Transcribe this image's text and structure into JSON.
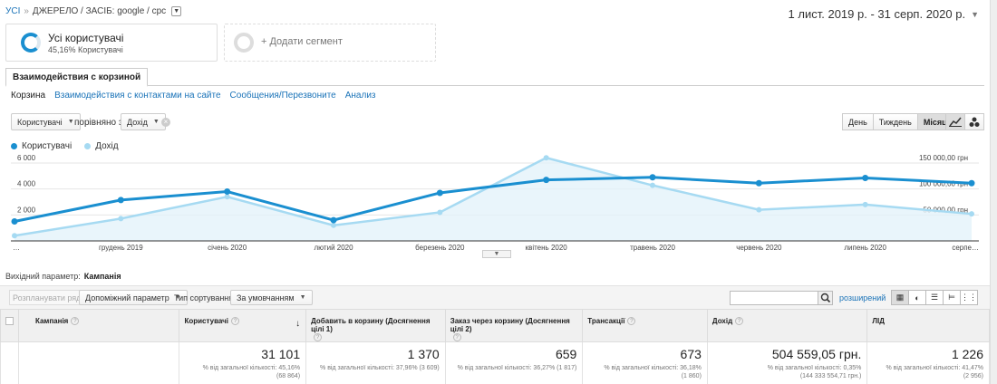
{
  "breadcrumb": {
    "all": "УСІ",
    "sep": "»",
    "source": "ДЖЕРЕЛО / ЗАСІБ: google / cpc"
  },
  "date_range": "1 лист. 2019 р. - 31 серп. 2020 р.",
  "segments": [
    {
      "title": "Усі користувачі",
      "subtitle": "45,16% Користувачі"
    },
    {
      "title": "+ Додати сегмент"
    }
  ],
  "tab": "Взаимодействия с корзиной",
  "subnav": [
    "Корзина",
    "Взаимодействия с контактами на сайте",
    "Сообщения/Перезвоните",
    "Анализ"
  ],
  "controls": {
    "metric1": "Користувачі",
    "compare_label": "порівняно з",
    "metric2": "Дохід",
    "periods": [
      "День",
      "Тиждень",
      "Місяць"
    ],
    "active_period": "Місяць"
  },
  "chart_data": {
    "type": "line",
    "x": [
      "…",
      "грудень 2019",
      "січень 2020",
      "лютий 2020",
      "березень 2020",
      "квітень 2020",
      "травень 2020",
      "червень 2020",
      "липень 2020",
      "серпе…"
    ],
    "series": [
      {
        "name": "Користувачі",
        "axis": "left",
        "color": "#1a8fd0",
        "values": [
          1500,
          3150,
          3800,
          1600,
          3700,
          4700,
          4900,
          4450,
          4850,
          4450
        ]
      },
      {
        "name": "Дохід",
        "axis": "right",
        "color": "#a6daf2",
        "values": [
          10000,
          43000,
          85000,
          30000,
          55000,
          160000,
          107000,
          60000,
          70000,
          52000
        ]
      }
    ],
    "left_ticks": [
      "2 000",
      "4 000",
      "6 000"
    ],
    "left_tick_values": [
      2000,
      4000,
      6000
    ],
    "right_ticks": [
      "50 000,00 грн",
      "100 000,00 грн",
      "150 000,00 грн"
    ],
    "right_tick_values": [
      50000,
      100000,
      150000
    ],
    "left_range": [
      0,
      6000
    ],
    "right_range": [
      0,
      150000
    ],
    "legend": "top-left",
    "grid": true
  },
  "primary_dim": {
    "label": "Вихідний параметр:",
    "value": "Кампанія"
  },
  "toolbar": {
    "plot_rows": "Розпланувати ряди",
    "secondary": "Допоміжний параметр",
    "sort_label": "Тип сортування:",
    "sort_value": "За умовчанням",
    "advanced": "розширений"
  },
  "table": {
    "headers": [
      "Кампанія",
      "Користувачі",
      "Добавить в корзину (Досягнення цілі 1)",
      "Заказ через корзину (Досягнення цілі 2)",
      "Трансакції",
      "Дохід",
      "ЛІД"
    ],
    "totals": [
      {
        "value": "31 101",
        "pct": "% від загальної кількості: 45,16%",
        "abs": "(68 864)"
      },
      {
        "value": "1 370",
        "pct": "% від загальної кількості: 37,96% (3 609)",
        "abs": ""
      },
      {
        "value": "659",
        "pct": "% від загальної кількості: 36,27% (1 817)",
        "abs": ""
      },
      {
        "value": "673",
        "pct": "% від загальної кількості: 36,18%",
        "abs": "(1 860)"
      },
      {
        "value": "504 559,05 грн.",
        "pct": "% від загальної кількості: 0,35%",
        "abs": "(144 333 554,71 грн.)"
      },
      {
        "value": "1 226",
        "pct": "% від загальної кількості: 41,47%",
        "abs": "(2 956)"
      }
    ]
  }
}
